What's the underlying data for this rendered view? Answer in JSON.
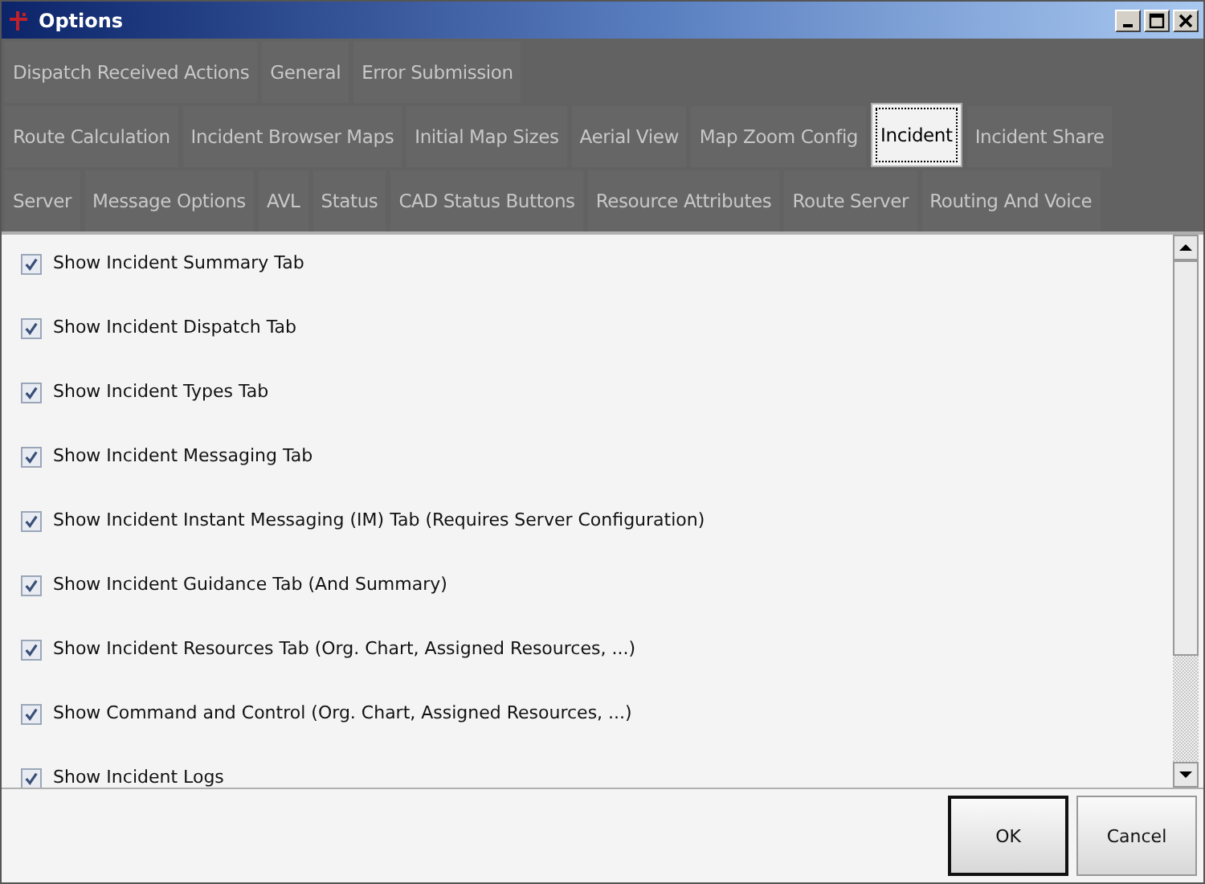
{
  "window": {
    "title": "Options"
  },
  "tab_rows": [
    [
      {
        "label": "Dispatch Received Actions",
        "selected": false
      },
      {
        "label": "General",
        "selected": false
      },
      {
        "label": "Error Submission",
        "selected": false
      }
    ],
    [
      {
        "label": "Route Calculation",
        "selected": false
      },
      {
        "label": "Incident Browser Maps",
        "selected": false
      },
      {
        "label": "Initial Map Sizes",
        "selected": false
      },
      {
        "label": "Aerial View",
        "selected": false
      },
      {
        "label": "Map Zoom Config",
        "selected": false
      },
      {
        "label": "Incident",
        "selected": true
      },
      {
        "label": "Incident Share",
        "selected": false
      }
    ],
    [
      {
        "label": "Server",
        "selected": false
      },
      {
        "label": "Message Options",
        "selected": false
      },
      {
        "label": "AVL",
        "selected": false
      },
      {
        "label": "Status",
        "selected": false
      },
      {
        "label": "CAD Status Buttons",
        "selected": false
      },
      {
        "label": "Resource Attributes",
        "selected": false
      },
      {
        "label": "Route Server",
        "selected": false
      },
      {
        "label": "Routing And Voice",
        "selected": false
      }
    ]
  ],
  "options": [
    {
      "label": "Show Incident Summary Tab",
      "checked": true
    },
    {
      "label": "Show Incident Dispatch Tab",
      "checked": true
    },
    {
      "label": "Show Incident Types Tab",
      "checked": true
    },
    {
      "label": "Show Incident Messaging Tab",
      "checked": true
    },
    {
      "label": "Show Incident Instant Messaging (IM) Tab (Requires Server Configuration)",
      "checked": true
    },
    {
      "label": "Show Incident Guidance Tab (And Summary)",
      "checked": true
    },
    {
      "label": "Show Incident Resources Tab (Org. Chart, Assigned Resources, ...)",
      "checked": true
    },
    {
      "label": "Show Command and Control (Org. Chart, Assigned Resources, ...)",
      "checked": true
    },
    {
      "label": "Show Incident Logs",
      "checked": true
    }
  ],
  "buttons": [
    {
      "label": "OK",
      "default": true
    },
    {
      "label": "Cancel",
      "default": false
    }
  ]
}
